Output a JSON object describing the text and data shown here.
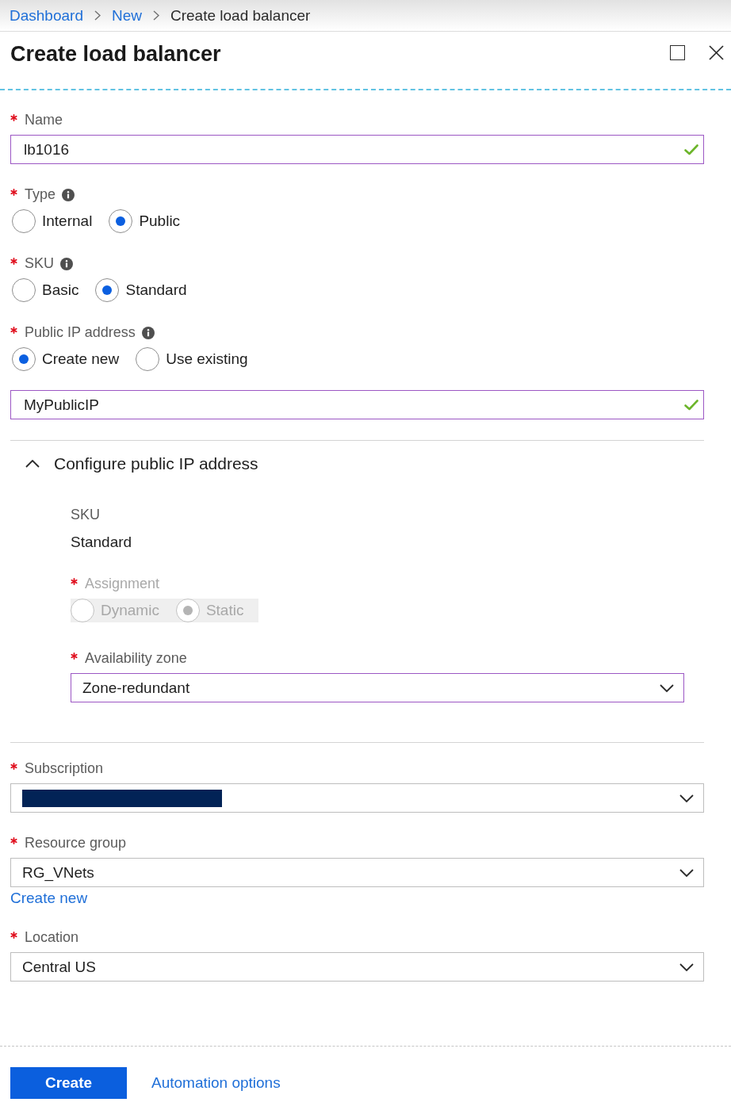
{
  "breadcrumb": [
    {
      "label": "Dashboard",
      "kind": "link"
    },
    {
      "label": "New",
      "kind": "link"
    },
    {
      "label": "Create load balancer",
      "kind": "current"
    }
  ],
  "blade": {
    "title": "Create load balancer"
  },
  "fields": [
    {
      "kind": "input",
      "label": "Name",
      "required": true,
      "value": "lb1016",
      "highlighted": true,
      "valid": true
    },
    {
      "kind": "radio",
      "label": "Type",
      "required": true,
      "info": true,
      "options": [
        {
          "label": "Internal",
          "selected": false
        },
        {
          "label": "Public",
          "selected": true
        }
      ]
    },
    {
      "kind": "radio",
      "label": "SKU",
      "required": true,
      "info": true,
      "options": [
        {
          "label": "Basic",
          "selected": false
        },
        {
          "label": "Standard",
          "selected": true
        }
      ]
    },
    {
      "kind": "radio",
      "label": "Public IP address",
      "required": true,
      "info": true,
      "options": [
        {
          "label": "Create new",
          "selected": true
        },
        {
          "label": "Use existing",
          "selected": false
        }
      ]
    },
    {
      "kind": "input",
      "value": "MyPublicIP",
      "highlighted": true,
      "valid": true
    },
    {
      "kind": "section",
      "title": "Configure public IP address",
      "expanded": true,
      "items": [
        {
          "kind": "static",
          "label": "SKU",
          "value": "Standard"
        },
        {
          "kind": "radio",
          "label": "Assignment",
          "required": true,
          "disabled": true,
          "options": [
            {
              "label": "Dynamic",
              "selected": false
            },
            {
              "label": "Static",
              "selected": true
            }
          ]
        },
        {
          "kind": "dropdown",
          "label": "Availability zone",
          "required": true,
          "value": "Zone-redundant",
          "highlighted": true
        }
      ]
    },
    {
      "kind": "dropdown",
      "label": "Subscription",
      "required": true,
      "redacted": true,
      "highlighted": false
    },
    {
      "kind": "dropdown",
      "label": "Resource group",
      "required": true,
      "value": "RG_VNets",
      "link": "Create new",
      "highlighted": false
    },
    {
      "kind": "dropdown",
      "label": "Location",
      "required": true,
      "value": "Central US",
      "highlighted": false
    }
  ],
  "footer": {
    "button": "Create",
    "link": "Automation options"
  }
}
